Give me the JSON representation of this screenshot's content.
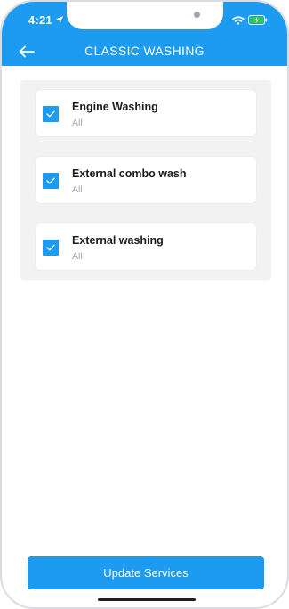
{
  "status_bar": {
    "time": "4:21"
  },
  "header": {
    "title": "CLASSIC WASHING",
    "back_icon": "arrow-left-icon"
  },
  "services": [
    {
      "label": "Engine Washing",
      "subtitle": "All",
      "checked": true
    },
    {
      "label": "External combo wash",
      "subtitle": "All",
      "checked": true
    },
    {
      "label": "External washing",
      "subtitle": "All",
      "checked": true
    }
  ],
  "footer": {
    "button_label": "Update Services"
  },
  "colors": {
    "primary": "#1d9bf0",
    "list_background": "#f2f2f3",
    "title_text": "#1c1c1c",
    "subtitle_text": "#a6a6a6"
  }
}
